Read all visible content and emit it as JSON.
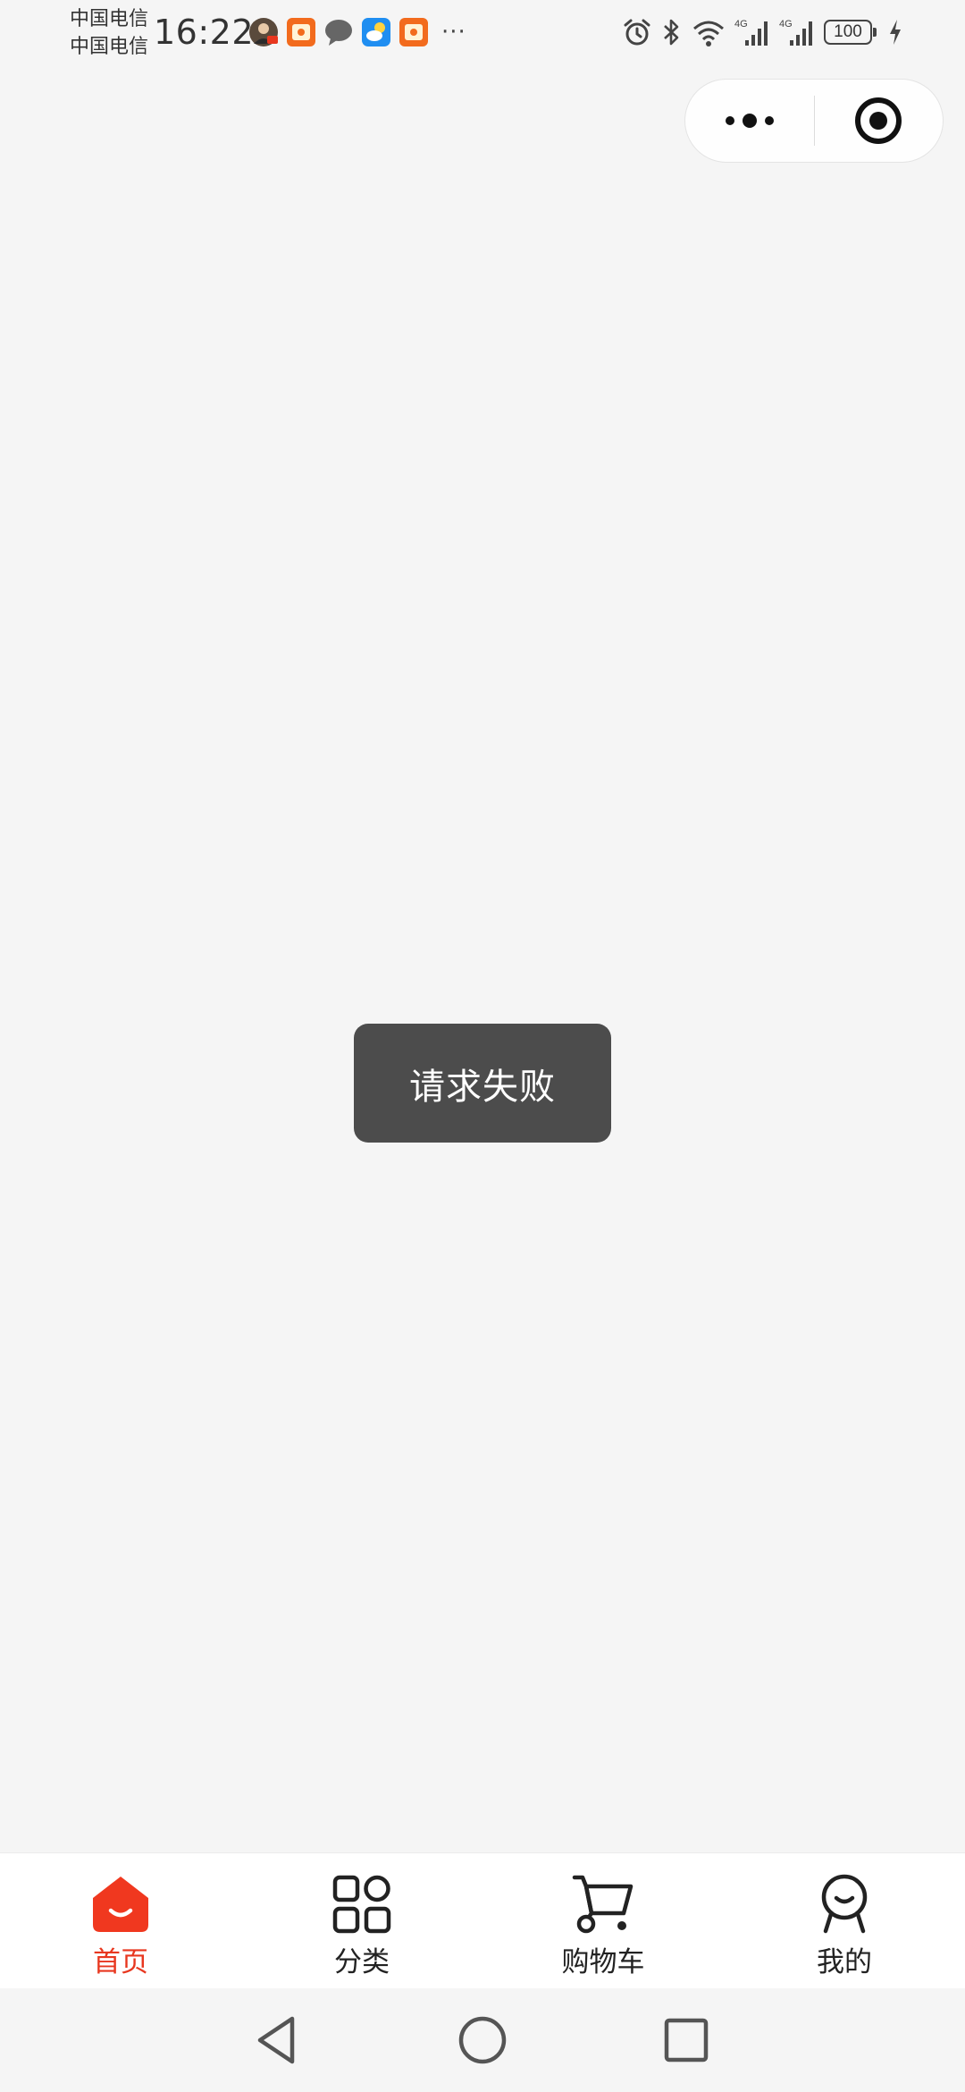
{
  "status_bar": {
    "carrier_line1": "中国电信",
    "carrier_line2": "中国电信",
    "time": "16:22",
    "notification_icons": [
      "avatar-icon",
      "red-packet-icon",
      "chat-bubble-icon",
      "weather-icon",
      "red-packet-icon"
    ],
    "more_indicator": "···",
    "network_type_1": "4G",
    "network_type_2": "4G",
    "battery_level": "100"
  },
  "capsule": {
    "more_icon": "more-dots-icon",
    "close_icon": "target-close-icon"
  },
  "toast": {
    "message": "请求失败"
  },
  "tabbar": {
    "tabs": [
      {
        "label": "首页",
        "icon": "home-icon",
        "active": true
      },
      {
        "label": "分类",
        "icon": "category-grid-icon",
        "active": false
      },
      {
        "label": "购物车",
        "icon": "cart-icon",
        "active": false
      },
      {
        "label": "我的",
        "icon": "profile-icon",
        "active": false
      }
    ]
  },
  "colors": {
    "accent": "#e8371f",
    "background": "#f5f5f5",
    "toast_bg": "#4c4c4c"
  },
  "navigation": {
    "buttons": [
      "back-icon",
      "home-circle-icon",
      "recents-icon"
    ]
  }
}
